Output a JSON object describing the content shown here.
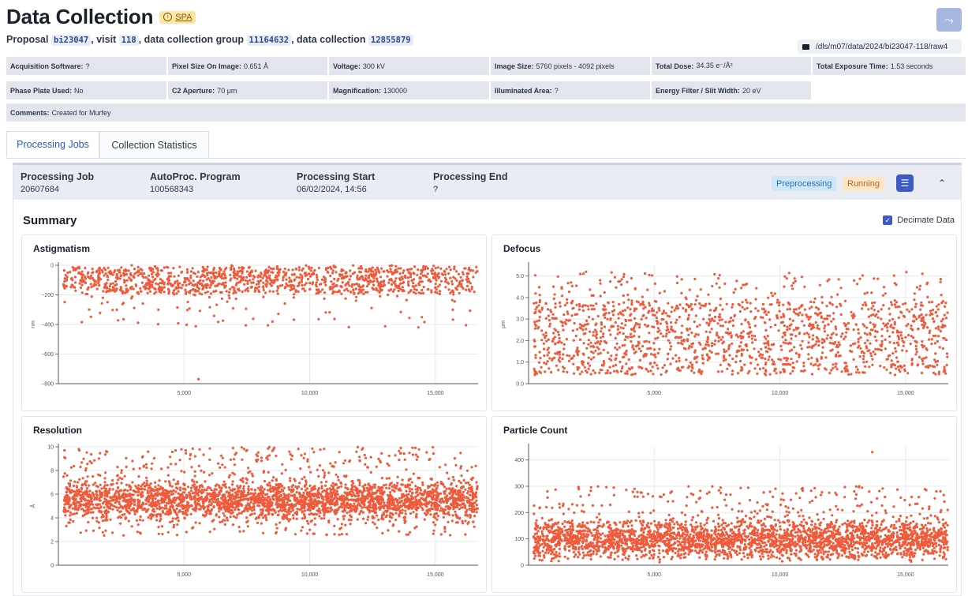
{
  "header": {
    "title": "Data Collection",
    "badge": "SPA",
    "subtitle": {
      "proposal_label": "Proposal",
      "proposal": "bi23047",
      "visit_label": ", visit",
      "visit": "118",
      "group_label": ", data collection group",
      "group": "11164632",
      "collection_label": ", data collection",
      "collection": "12855879"
    },
    "path": "/dls/m07/data/2024/bi23047-118/raw4"
  },
  "params": [
    {
      "label": "Acquisition Software:",
      "value": "?"
    },
    {
      "label": "Pixel Size On Image:",
      "value": "0.651 Å"
    },
    {
      "label": "Voltage:",
      "value": "300 kV"
    },
    {
      "label": "Image Size:",
      "value": "5760 pixels - 4092 pixels"
    },
    {
      "label": "Total Dose:",
      "value": "34.35 e⁻/Å²"
    },
    {
      "label": "Total Exposure Time:",
      "value": "1.53 seconds"
    },
    {
      "label": "Phase Plate Used:",
      "value": "No"
    },
    {
      "label": "C2 Aperture:",
      "value": "70 μm"
    },
    {
      "label": "Magnification:",
      "value": "130000"
    },
    {
      "label": "Illuminated Area:",
      "value": "?"
    },
    {
      "label": "Energy Filter / Slit Width:",
      "value": "20 eV"
    },
    {
      "label": "Comments:",
      "value": "Created for Murfey"
    }
  ],
  "tabs": [
    {
      "label": "Processing Jobs",
      "active": true
    },
    {
      "label": "Collection Statistics",
      "active": false
    }
  ],
  "job": {
    "cols": [
      {
        "label": "Processing Job",
        "value": "20607684"
      },
      {
        "label": "AutoProc. Program",
        "value": "100568343"
      },
      {
        "label": "Processing Start",
        "value": "06/02/2024, 14:56"
      },
      {
        "label": "Processing End",
        "value": "?"
      }
    ],
    "tag_preprocessing": "Preprocessing",
    "tag_running": "Running"
  },
  "summary": {
    "title": "Summary",
    "decimate_label": "Decimate Data",
    "decimate_checked": true
  },
  "chart_data": [
    {
      "type": "scatter",
      "title": "Astigmatism",
      "xlabel": "",
      "ylabel": "nm",
      "xlim": [
        0,
        16700
      ],
      "ylim": [
        -800,
        0
      ],
      "xticks": [
        5000,
        10000,
        15000
      ],
      "xtick_labels": [
        "5,000",
        "10,000",
        "15,000"
      ],
      "yticks": [
        0,
        -200,
        -400,
        -600,
        -800
      ],
      "ytick_labels": [
        "0",
        "−200",
        "−400",
        "−600",
        "−800"
      ],
      "color": "#f05a3a",
      "n_points": 1300,
      "typical_range": [
        -200,
        0
      ]
    },
    {
      "type": "scatter",
      "title": "Defocus",
      "xlabel": "",
      "ylabel": "μm",
      "xlim": [
        0,
        16700
      ],
      "ylim": [
        0,
        5.5
      ],
      "xticks": [
        5000,
        10000,
        15000
      ],
      "xtick_labels": [
        "5,000",
        "10,000",
        "15,000"
      ],
      "yticks": [
        0,
        1,
        2,
        3,
        4,
        5
      ],
      "ytick_labels": [
        "0.0",
        "1.0",
        "2.0",
        "3.0",
        "4.0",
        "5.0"
      ],
      "color": "#f05a3a",
      "n_points": 1600,
      "typical_range": [
        0.5,
        3.5
      ]
    },
    {
      "type": "scatter",
      "title": "Resolution",
      "xlabel": "",
      "ylabel": "Å",
      "xlim": [
        0,
        16700
      ],
      "ylim": [
        0,
        10
      ],
      "xticks": [
        5000,
        10000,
        15000
      ],
      "xtick_labels": [
        "5,000",
        "10,000",
        "15,000"
      ],
      "yticks": [
        0,
        2,
        4,
        6,
        8,
        10
      ],
      "ytick_labels": [
        "0",
        "2",
        "4",
        "6",
        "8",
        "10"
      ],
      "color": "#f05a3a",
      "n_points": 3200,
      "typical_range": [
        3,
        8
      ]
    },
    {
      "type": "scatter",
      "title": "Particle Count",
      "xlabel": "",
      "ylabel": "",
      "xlim": [
        0,
        16700
      ],
      "ylim": [
        0,
        450
      ],
      "xticks": [
        5000,
        10000,
        15000
      ],
      "xtick_labels": [
        "5,000",
        "10,000",
        "15,000"
      ],
      "yticks": [
        0,
        100,
        200,
        300,
        400
      ],
      "ytick_labels": [
        "0",
        "100",
        "200",
        "300",
        "400"
      ],
      "color": "#f05a3a",
      "n_points": 3000,
      "typical_range": [
        0,
        200
      ]
    }
  ]
}
